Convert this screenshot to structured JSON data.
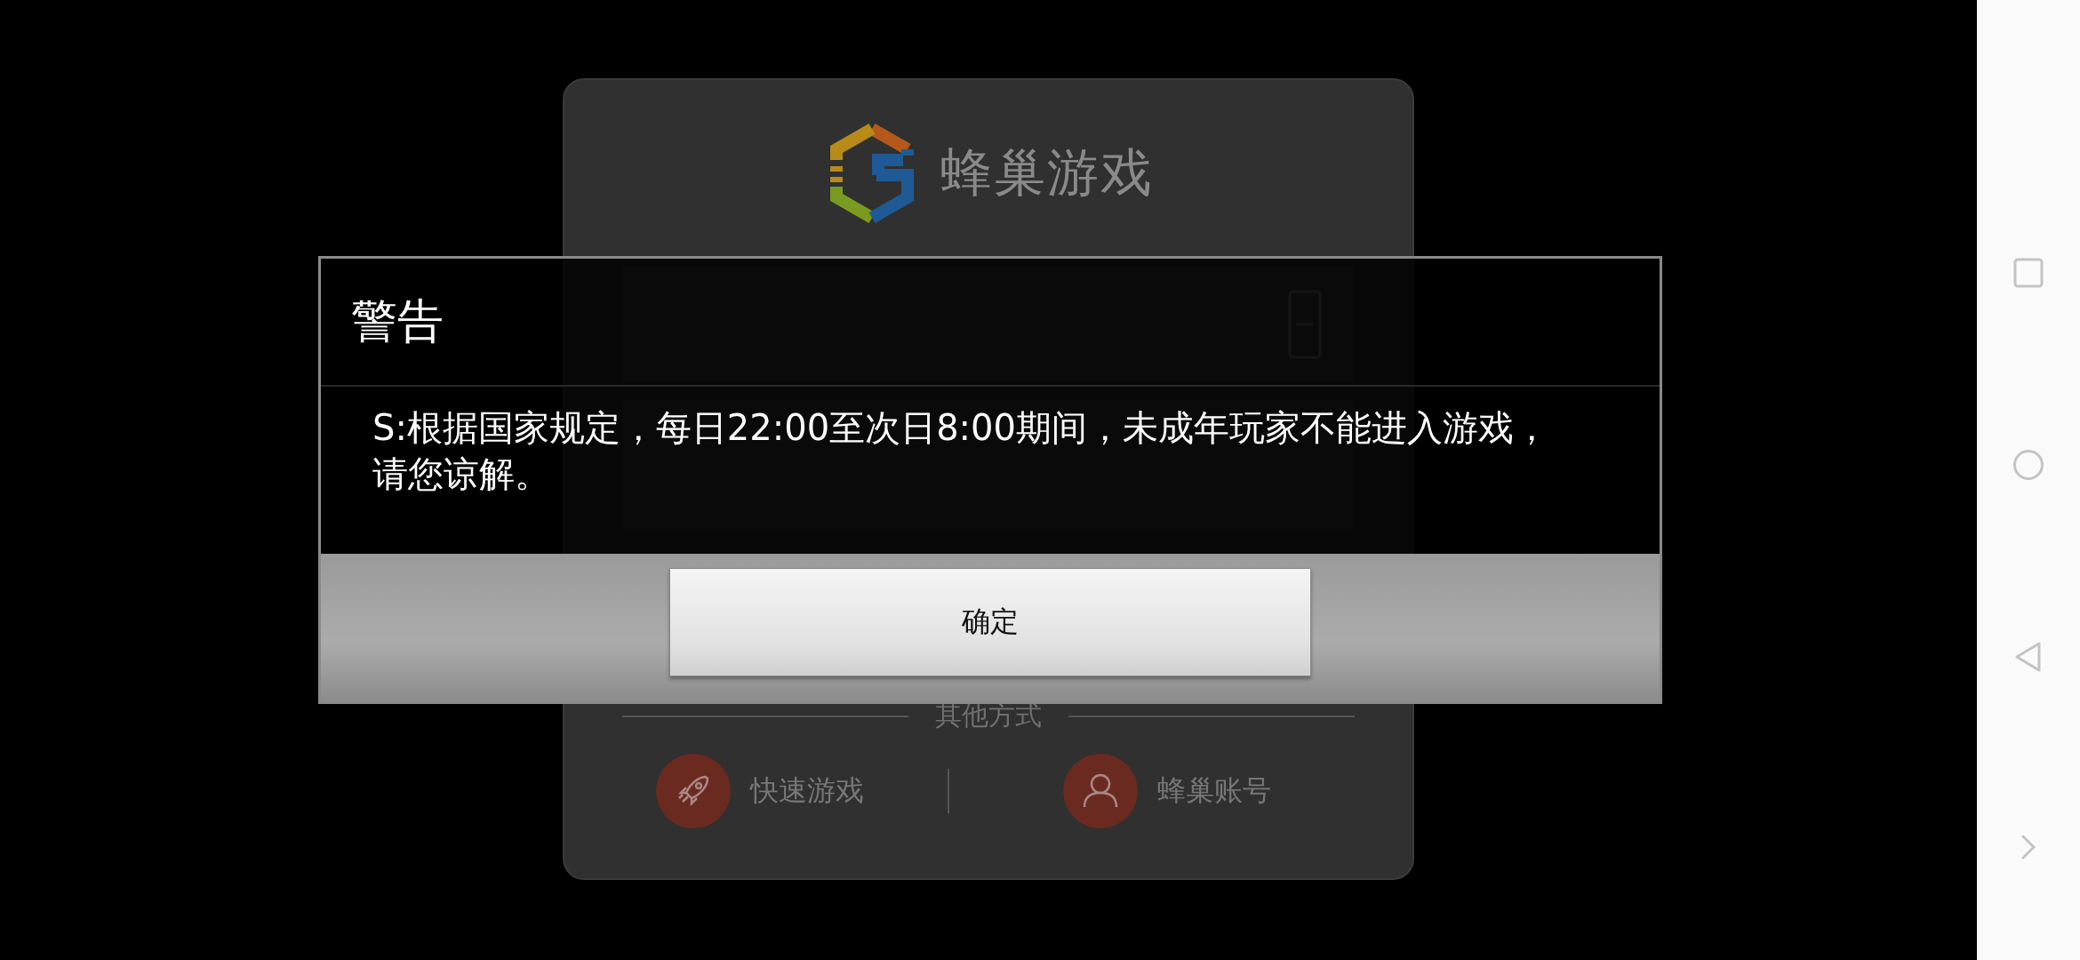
{
  "login_card": {
    "logo_text": "蜂巢游戏",
    "divider_label": "其他方式",
    "options": [
      {
        "label": "快速游戏",
        "kind": "rocket"
      },
      {
        "label": "蜂巢账号",
        "kind": "user"
      }
    ]
  },
  "dialog": {
    "title": "警告",
    "message": "S:根据国家规定，每日22:00至次日8:00期间，未成年玩家不能进入游戏，请您谅解。",
    "buttons": [
      "确定"
    ]
  }
}
